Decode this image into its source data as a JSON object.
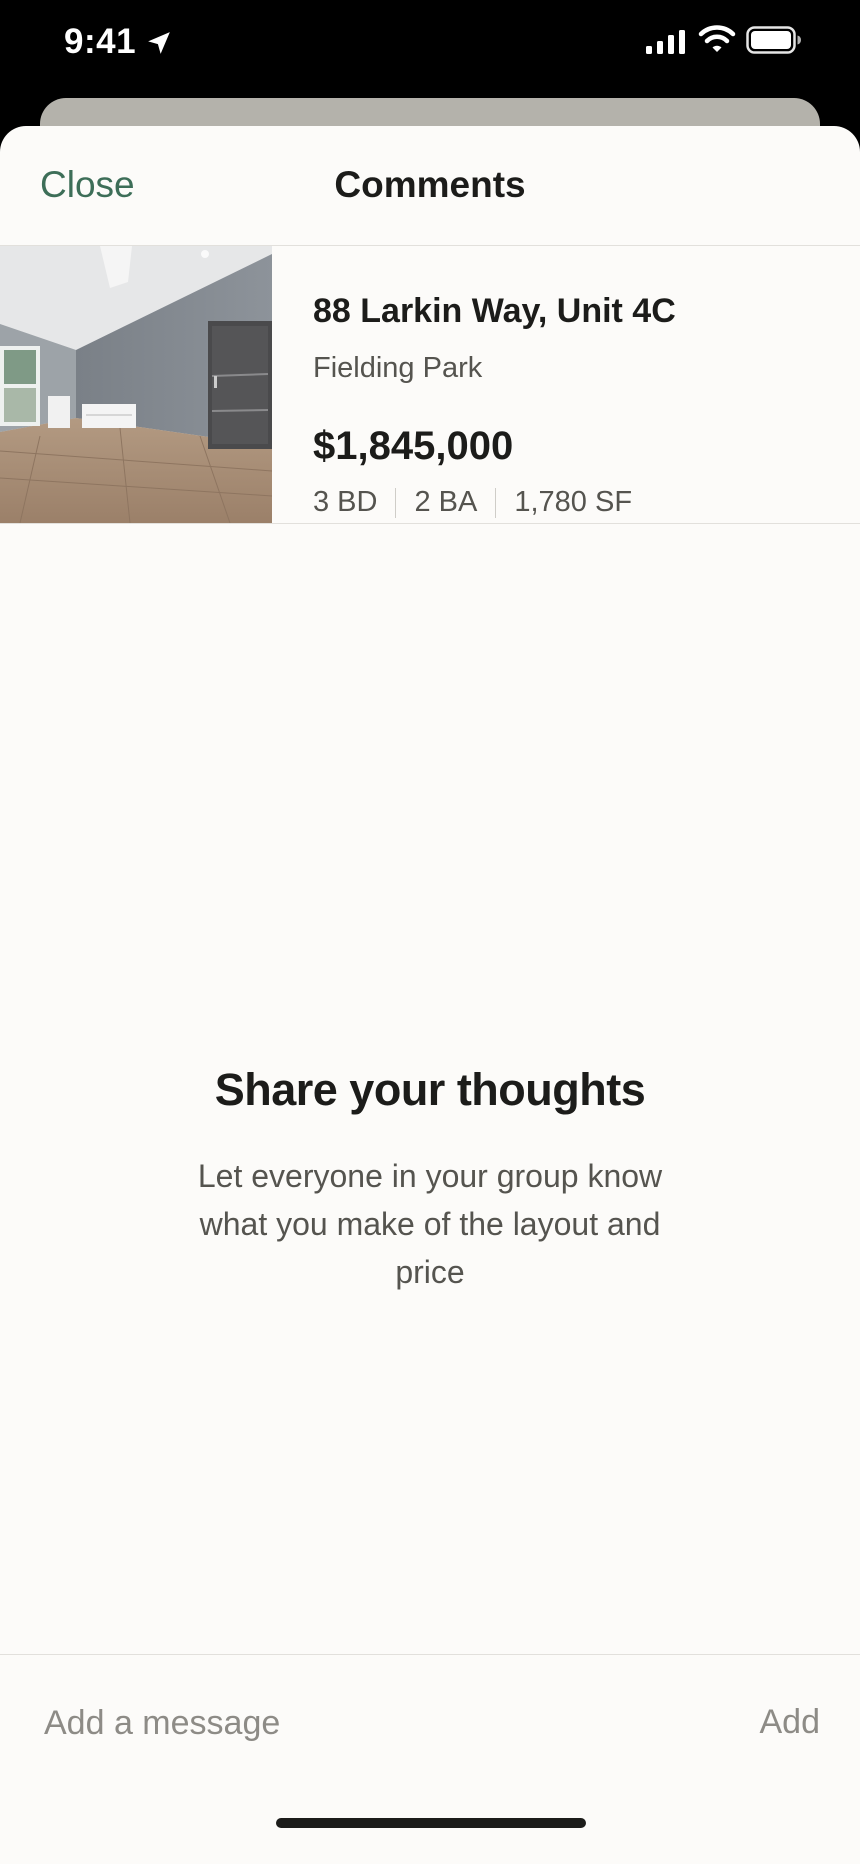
{
  "status_bar": {
    "time": "9:41",
    "icons": [
      "location-arrow-icon",
      "cellular-signal-icon",
      "wifi-icon",
      "battery-icon"
    ]
  },
  "nav": {
    "close_label": "Close",
    "title": "Comments"
  },
  "listing": {
    "photo": "room-photo",
    "address": "88 Larkin Way, Unit 4C",
    "neighborhood": "Fielding Park",
    "price": "$1,845,000",
    "beds": "3 BD",
    "baths": "2 BA",
    "area": "1,780 SF"
  },
  "empty_state": {
    "title": "Share your thoughts",
    "body": "Let everyone in your group know what you make of the layout and price"
  },
  "composer": {
    "placeholder": "Add a message",
    "value": "",
    "add_label": "Add"
  },
  "colors": {
    "accent": "#3d6e58",
    "sheet_background": "#fcfbf9",
    "text_primary": "#1c1c1a",
    "text_secondary": "#55544f",
    "text_muted": "#8d8b86"
  }
}
